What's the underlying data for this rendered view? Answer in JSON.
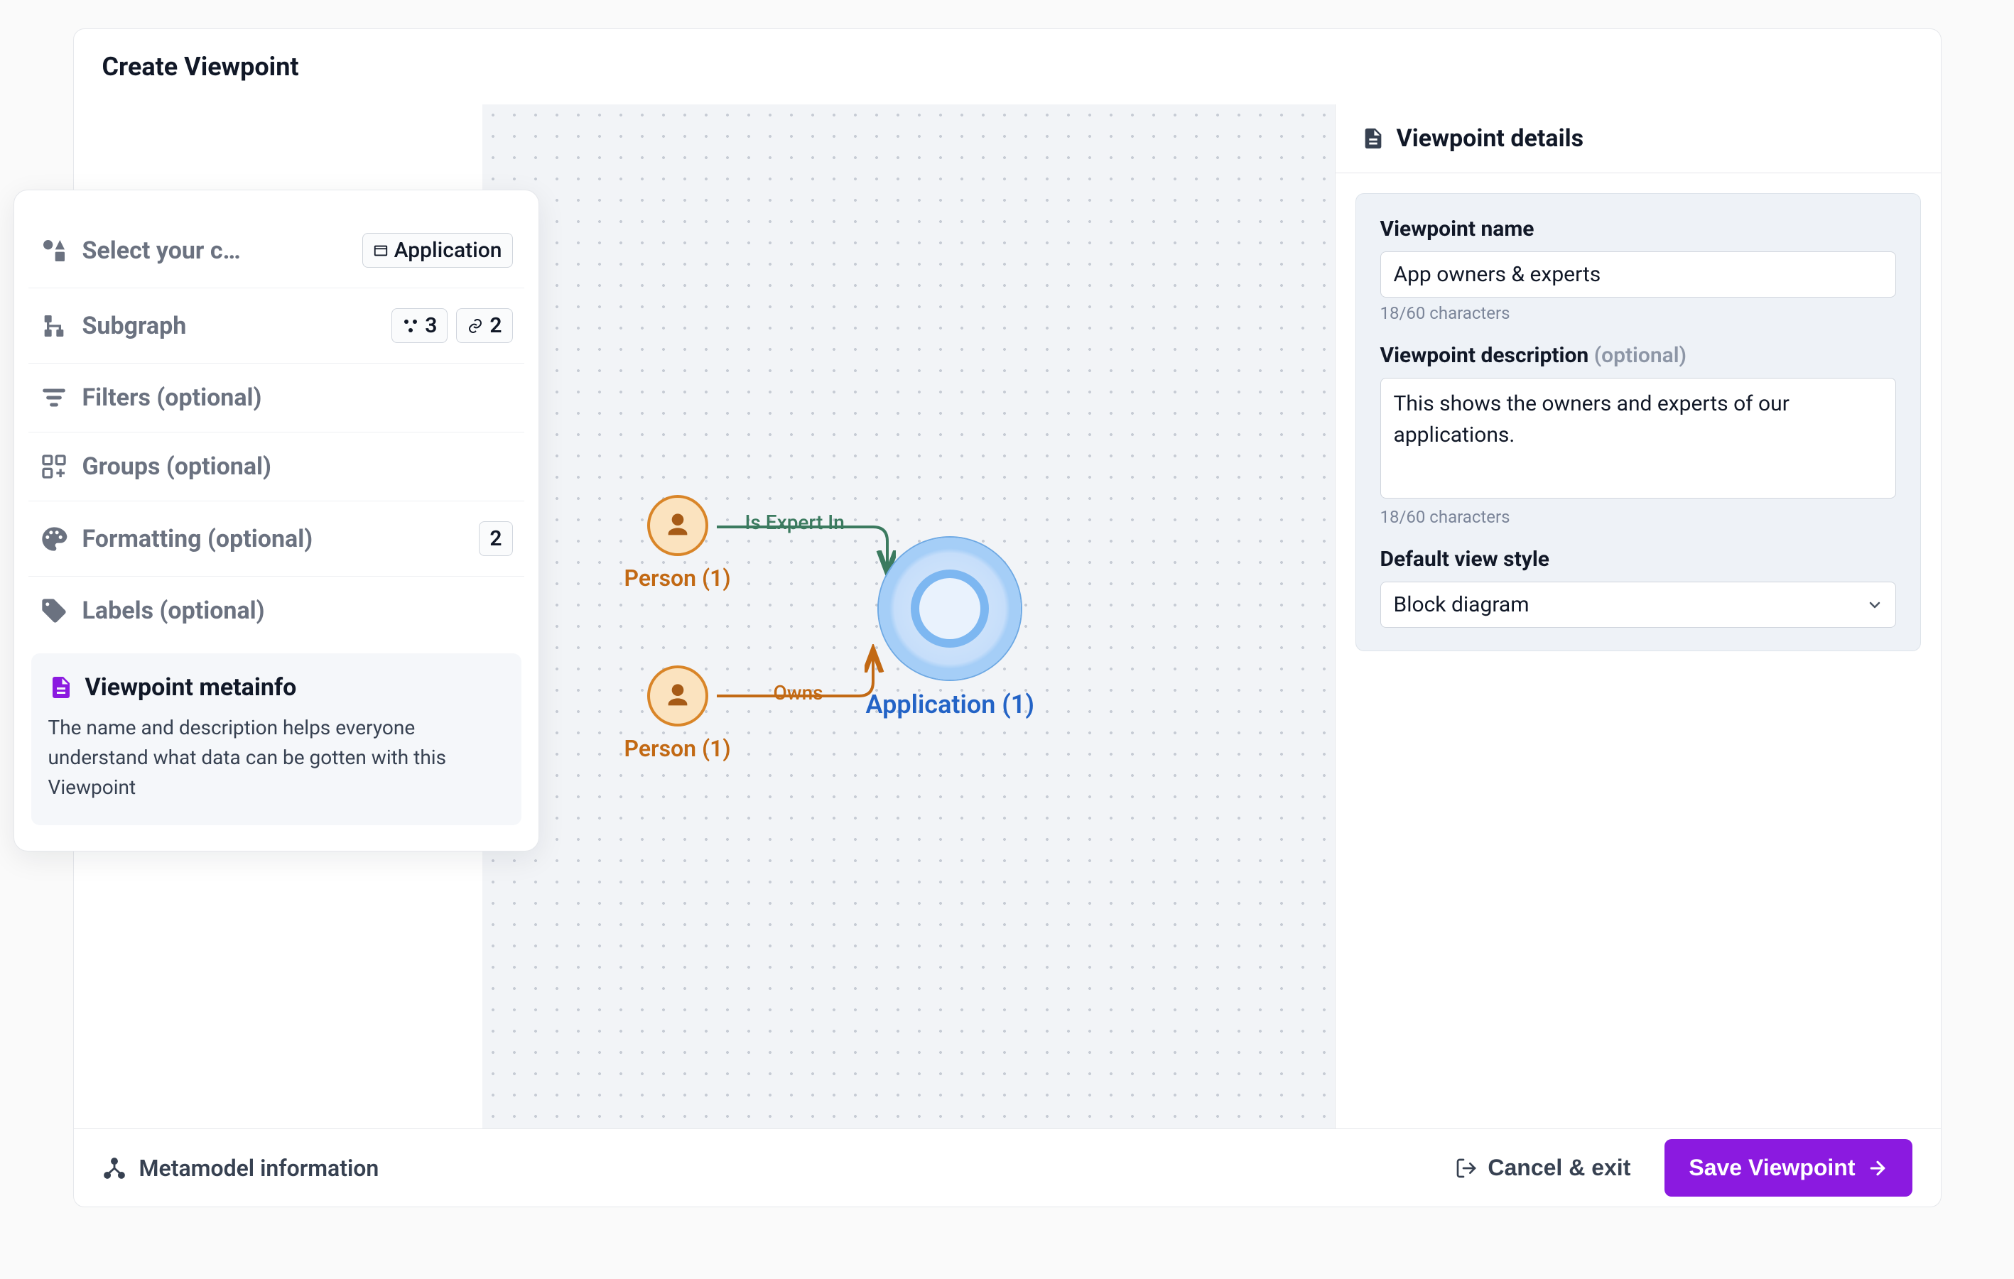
{
  "header": {
    "title": "Create Viewpoint"
  },
  "accordion": {
    "select_context": {
      "label": "Select your c…",
      "chip": {
        "label": "Application"
      }
    },
    "subgraph": {
      "label": "Subgraph",
      "nodes_count": "3",
      "links_count": "2"
    },
    "filters": {
      "label": "Filters (optional)"
    },
    "groups": {
      "label": "Groups (optional)"
    },
    "formatting": {
      "label": "Formatting (optional)",
      "count": "2"
    },
    "labels": {
      "label": "Labels (optional)"
    },
    "metainfo": {
      "title": "Viewpoint metainfo",
      "description": "The name and description helps everyone understand what data can be gotten with this Viewpoint"
    }
  },
  "canvas": {
    "person1": {
      "label": "Person (1)"
    },
    "person2": {
      "label": "Person (1)"
    },
    "application": {
      "label": "Application (1)"
    },
    "edge_expert": {
      "label": "Is Expert In"
    },
    "edge_owns": {
      "label": "Owns"
    }
  },
  "details": {
    "title": "Viewpoint details",
    "name_label": "Viewpoint name",
    "name_value": "App owners & experts",
    "name_hint": "18/60 characters",
    "desc_label_main": "Viewpoint description",
    "desc_label_opt": "(optional)",
    "desc_value": "This shows the owners and experts of our applications.",
    "desc_hint": "18/60 characters",
    "style_label": "Default view style",
    "style_value": "Block diagram"
  },
  "footer": {
    "metamodel": "Metamodel information",
    "cancel": "Cancel & exit",
    "save": "Save Viewpoint"
  }
}
